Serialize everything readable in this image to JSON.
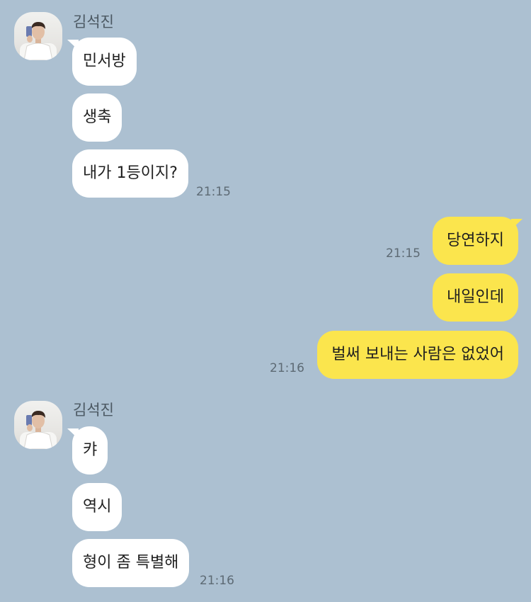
{
  "conversation": {
    "groups": [
      {
        "sender": "김석진",
        "messages": [
          "민서방",
          "생축",
          "내가 1등이지?"
        ],
        "time": "21:15"
      },
      {
        "sender": "me",
        "messages": [
          "당연하지",
          "내일인데",
          "벌써 보내는 사람은 없었어"
        ],
        "times": [
          "21:15",
          "21:16"
        ]
      },
      {
        "sender": "김석진",
        "messages": [
          "캬",
          "역시",
          "형이 좀 특별해"
        ],
        "time": "21:16"
      }
    ]
  },
  "colors": {
    "background": "#acc0d1",
    "incoming_bubble": "#ffffff",
    "outgoing_bubble": "#fbe54d",
    "timestamp": "#5d6a74"
  },
  "icons": {
    "avatar": "profile-photo"
  }
}
